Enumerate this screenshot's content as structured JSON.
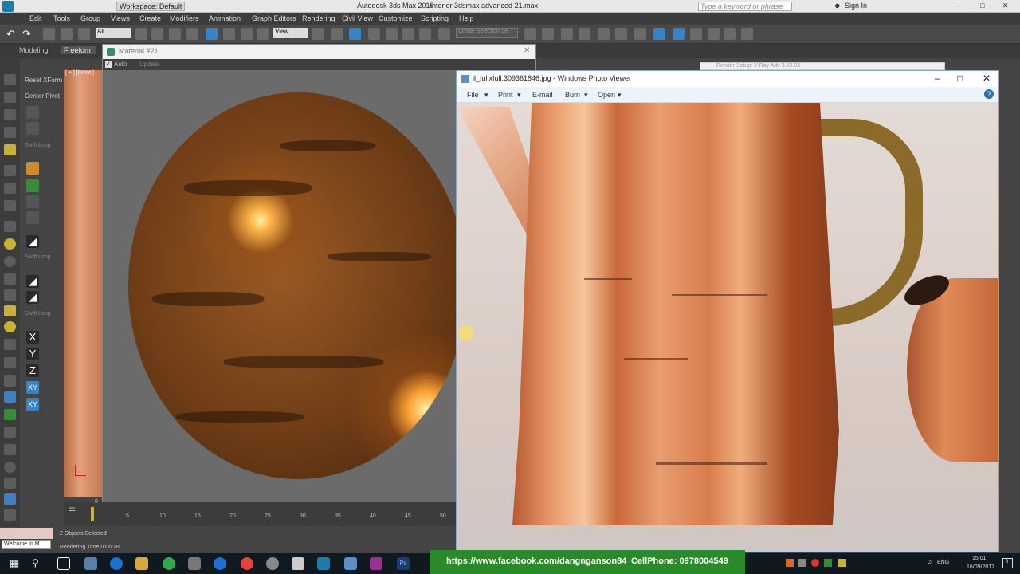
{
  "max": {
    "workspace": "Workspace: Default",
    "app_title": "Autodesk 3ds Max 2016",
    "file_title": "interior 3dsmax advanced 21.max",
    "search_placeholder": "Type a keyword or phrase",
    "sign_in": "Sign In",
    "menu": [
      "Edit",
      "Tools",
      "Group",
      "Views",
      "Create",
      "Modifiers",
      "Animation",
      "Graph Editors",
      "Rendering",
      "Civil View",
      "Customize",
      "Scripting",
      "Help"
    ],
    "selection_filter": "All",
    "view_dropdown": "View",
    "named_selection": "Create Selection Se",
    "ribbon_tabs": [
      "Modeling",
      "Freeform"
    ],
    "viewport_label": "[ + ] [Front ]"
  },
  "command_panel": {
    "reset_xform": "Reset XForm",
    "center_pivot": "Center Pivot",
    "swift_loop_1": "Swift Loop",
    "swift_loop_2": "Swift Loop",
    "swift_loop_3": "Swift Loop",
    "x": "X",
    "y": "Y",
    "z": "Z",
    "xy": "XY",
    "xy2": "XY"
  },
  "material_window": {
    "title": "Material #21",
    "auto_label": "Auto",
    "update_label": "Update"
  },
  "timeline": {
    "current_frame": "0",
    "ticks": [
      "5",
      "10",
      "15",
      "20",
      "25",
      "30",
      "35",
      "40",
      "45",
      "50"
    ]
  },
  "status": {
    "selection": "2 Objects Selected",
    "render_time": "Rendering Time  0:06:28",
    "welcome": "Welcome to M"
  },
  "render_setup": {
    "title": "Render Setup: V-Ray Adv 3.60.03"
  },
  "photo_viewer": {
    "title": "il_fullxfull.309361846.jpg - Windows Photo Viewer",
    "menu": [
      "File",
      "Print",
      "E-mail",
      "Burn",
      "Open"
    ]
  },
  "banner": {
    "facebook": "https://www.facebook.com/dangnganson84",
    "phone": "CellPhone: 0978004549"
  },
  "tray": {
    "lang": "ENG",
    "time": "15:01",
    "date": "16/09/2017",
    "notif_count": "3"
  },
  "colors": {
    "accent_blue": "#3b82c4",
    "banner_green": "#2a8a2a",
    "taskbar": "#101820"
  }
}
